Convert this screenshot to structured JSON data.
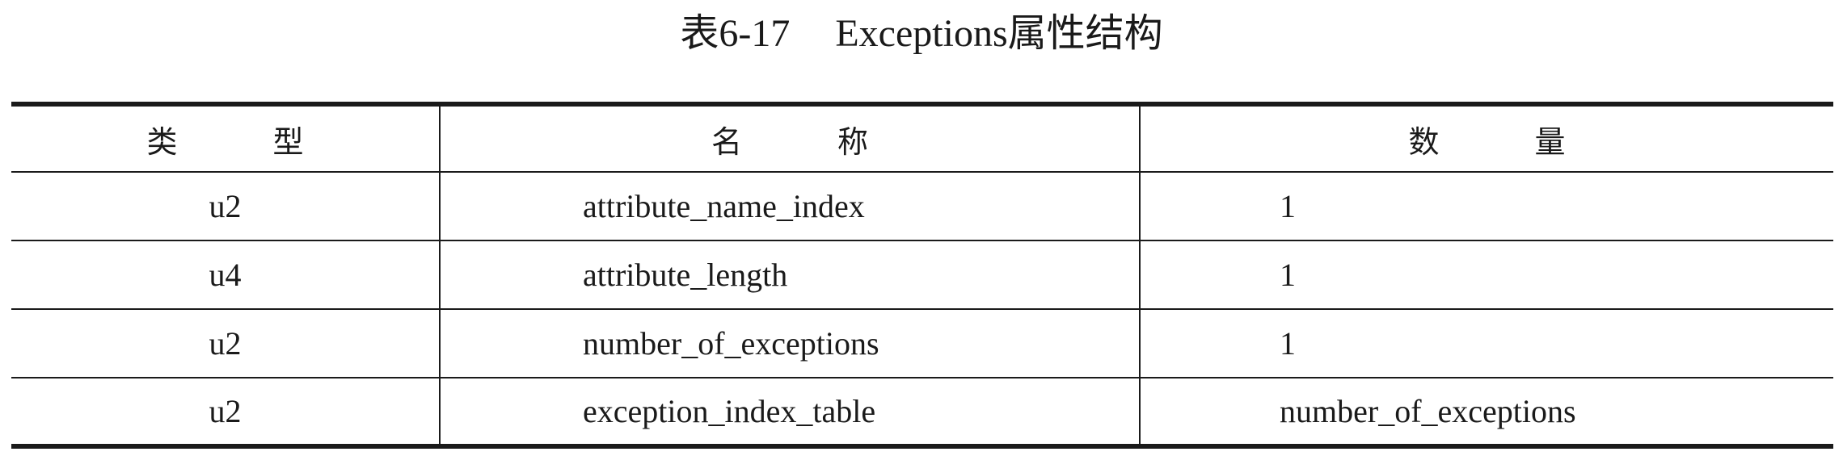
{
  "caption": {
    "number": "表6-17",
    "title": "Exceptions属性结构"
  },
  "table": {
    "headers": [
      [
        "类",
        "型"
      ],
      [
        "名",
        "称"
      ],
      [
        "数",
        "量"
      ]
    ],
    "rows": [
      {
        "type": "u2",
        "name": "attribute_name_index",
        "count": "1"
      },
      {
        "type": "u4",
        "name": "attribute_length",
        "count": "1"
      },
      {
        "type": "u2",
        "name": "number_of_exceptions",
        "count": "1"
      },
      {
        "type": "u2",
        "name": "exception_index_table",
        "count": "number_of_exceptions"
      }
    ]
  }
}
